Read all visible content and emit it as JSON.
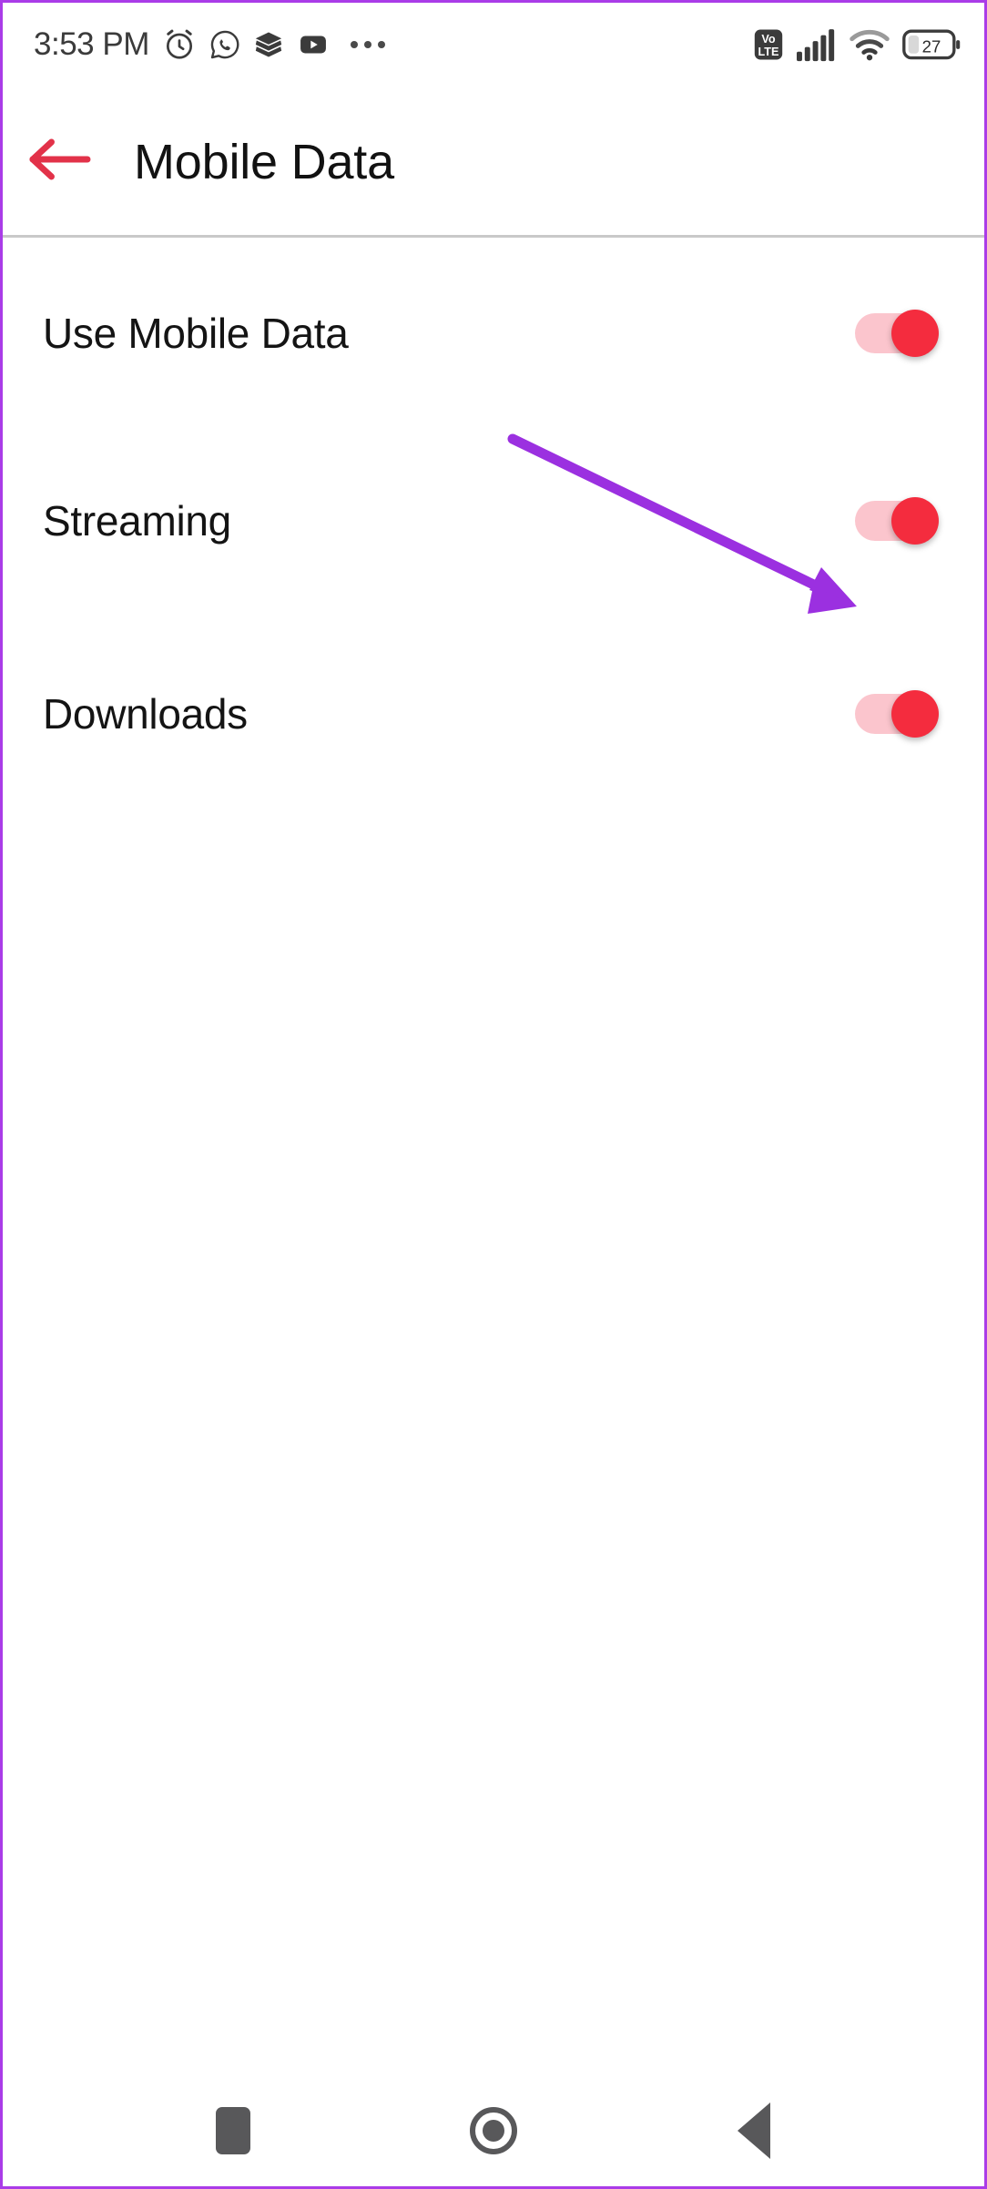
{
  "status_bar": {
    "time": "3:53 PM",
    "left_icons": [
      {
        "name": "alarm-clock-icon"
      },
      {
        "name": "whatsapp-icon"
      },
      {
        "name": "layers-stack-icon"
      },
      {
        "name": "youtube-icon"
      },
      {
        "name": "more-notifications-icon"
      }
    ],
    "right_icons": [
      {
        "name": "volte-icon",
        "label_top": "Vo",
        "label_bottom": "LTE"
      },
      {
        "name": "cellular-signal-icon",
        "bars": 5
      },
      {
        "name": "wifi-icon"
      },
      {
        "name": "battery-icon",
        "level": "27"
      }
    ]
  },
  "app_bar": {
    "back_label": "back-arrow",
    "title": "Mobile Data"
  },
  "settings": {
    "rows": [
      {
        "label": "Use Mobile Data",
        "toggle_state": "on"
      },
      {
        "label": "Streaming",
        "toggle_state": "on"
      },
      {
        "label": "Downloads",
        "toggle_state": "on"
      }
    ]
  },
  "annotation": {
    "type": "arrow",
    "color": "#9b30e0",
    "points_to": "Downloads toggle",
    "start": [
      560,
      480
    ],
    "end": [
      935,
      663
    ]
  },
  "nav_bar": {
    "buttons": [
      {
        "name": "recents",
        "label": "Recent apps"
      },
      {
        "name": "home",
        "label": "Home"
      },
      {
        "name": "back",
        "label": "Back"
      }
    ]
  },
  "colors": {
    "accent_red": "#f42c3e",
    "track_pink": "#fbc5cd",
    "back_arrow_red": "#e23249",
    "annotation_purple": "#9b30e0",
    "border_purple": "#aa3ce8",
    "divider_gray": "#c9c9c9",
    "nav_icon_gray": "#58585a",
    "status_icon_gray": "#3b3b3b"
  }
}
